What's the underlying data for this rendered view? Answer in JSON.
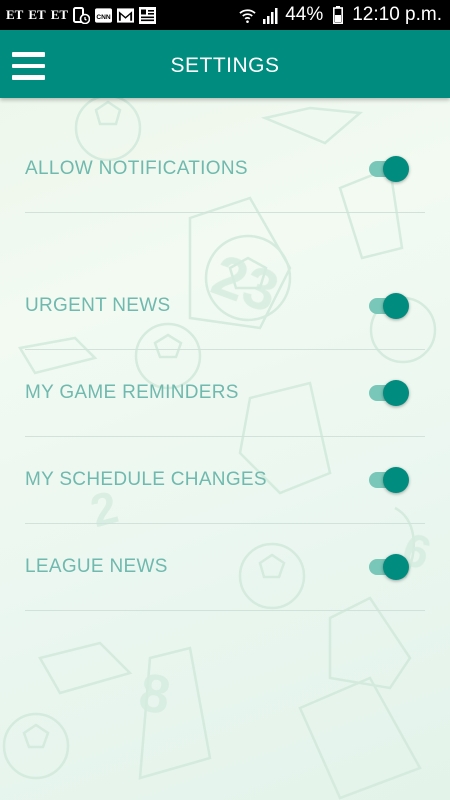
{
  "status_bar": {
    "left_icons": [
      "ET",
      "ET",
      "ET"
    ],
    "notification_icons": [
      "phone-clock-icon",
      "cnn-icon",
      "gmail-icon",
      "news-icon"
    ],
    "battery": "44%",
    "time": "12:10 p.m."
  },
  "app_bar": {
    "title": "SETTINGS",
    "menu_icon": "hamburger-menu-icon"
  },
  "settings": [
    {
      "label": "ALLOW NOTIFICATIONS",
      "enabled": true
    },
    {
      "label": "URGENT NEWS",
      "enabled": true
    },
    {
      "label": "MY GAME REMINDERS",
      "enabled": true
    },
    {
      "label": "MY SCHEDULE CHANGES",
      "enabled": true
    },
    {
      "label": "LEAGUE NEWS",
      "enabled": true
    }
  ],
  "colors": {
    "primary": "#008c7e",
    "toggle_track": "#79c7b9",
    "label": "#6fb9ae"
  }
}
